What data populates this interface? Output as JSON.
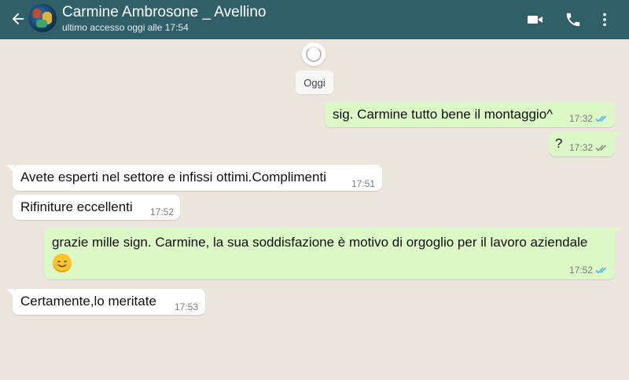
{
  "header": {
    "contact_name": "Carmine Ambrosone _ Avellino",
    "status": "ultimo accesso oggi alle 17:54",
    "icons": [
      "back-arrow-icon",
      "video-call-icon",
      "phone-icon",
      "more-vert-icon"
    ]
  },
  "chat": {
    "date_chip": "Oggi",
    "messages": [
      {
        "direction": "out",
        "text": "sig. Carmine tutto bene il montaggio^",
        "time": "17:32",
        "status": "read"
      },
      {
        "direction": "out",
        "text": "?",
        "time": "17:32",
        "status": "delivered"
      },
      {
        "direction": "in",
        "text": "Avete esperti nel settore e infissi ottimi.Complimenti",
        "time": "17:51"
      },
      {
        "direction": "in",
        "text": "Rifiniture eccellenti",
        "time": "17:52"
      },
      {
        "direction": "out",
        "text": "grazie mille sign. Carmine, la sua soddisfazione è motivo di orgoglio per il lavoro aziendale",
        "emoji": "smiling-face-icon",
        "time": "17:52",
        "status": "read"
      },
      {
        "direction": "in",
        "text": "Certamente,lo meritate",
        "time": "17:53"
      }
    ]
  },
  "colors": {
    "header_bg": "#2f5f68",
    "chat_bg": "#ece5dd",
    "outgoing_bubble": "#dcf8c6",
    "incoming_bubble": "#ffffff",
    "read_ticks": "#4fb6ec",
    "delivered_ticks": "#8e8e8e"
  }
}
